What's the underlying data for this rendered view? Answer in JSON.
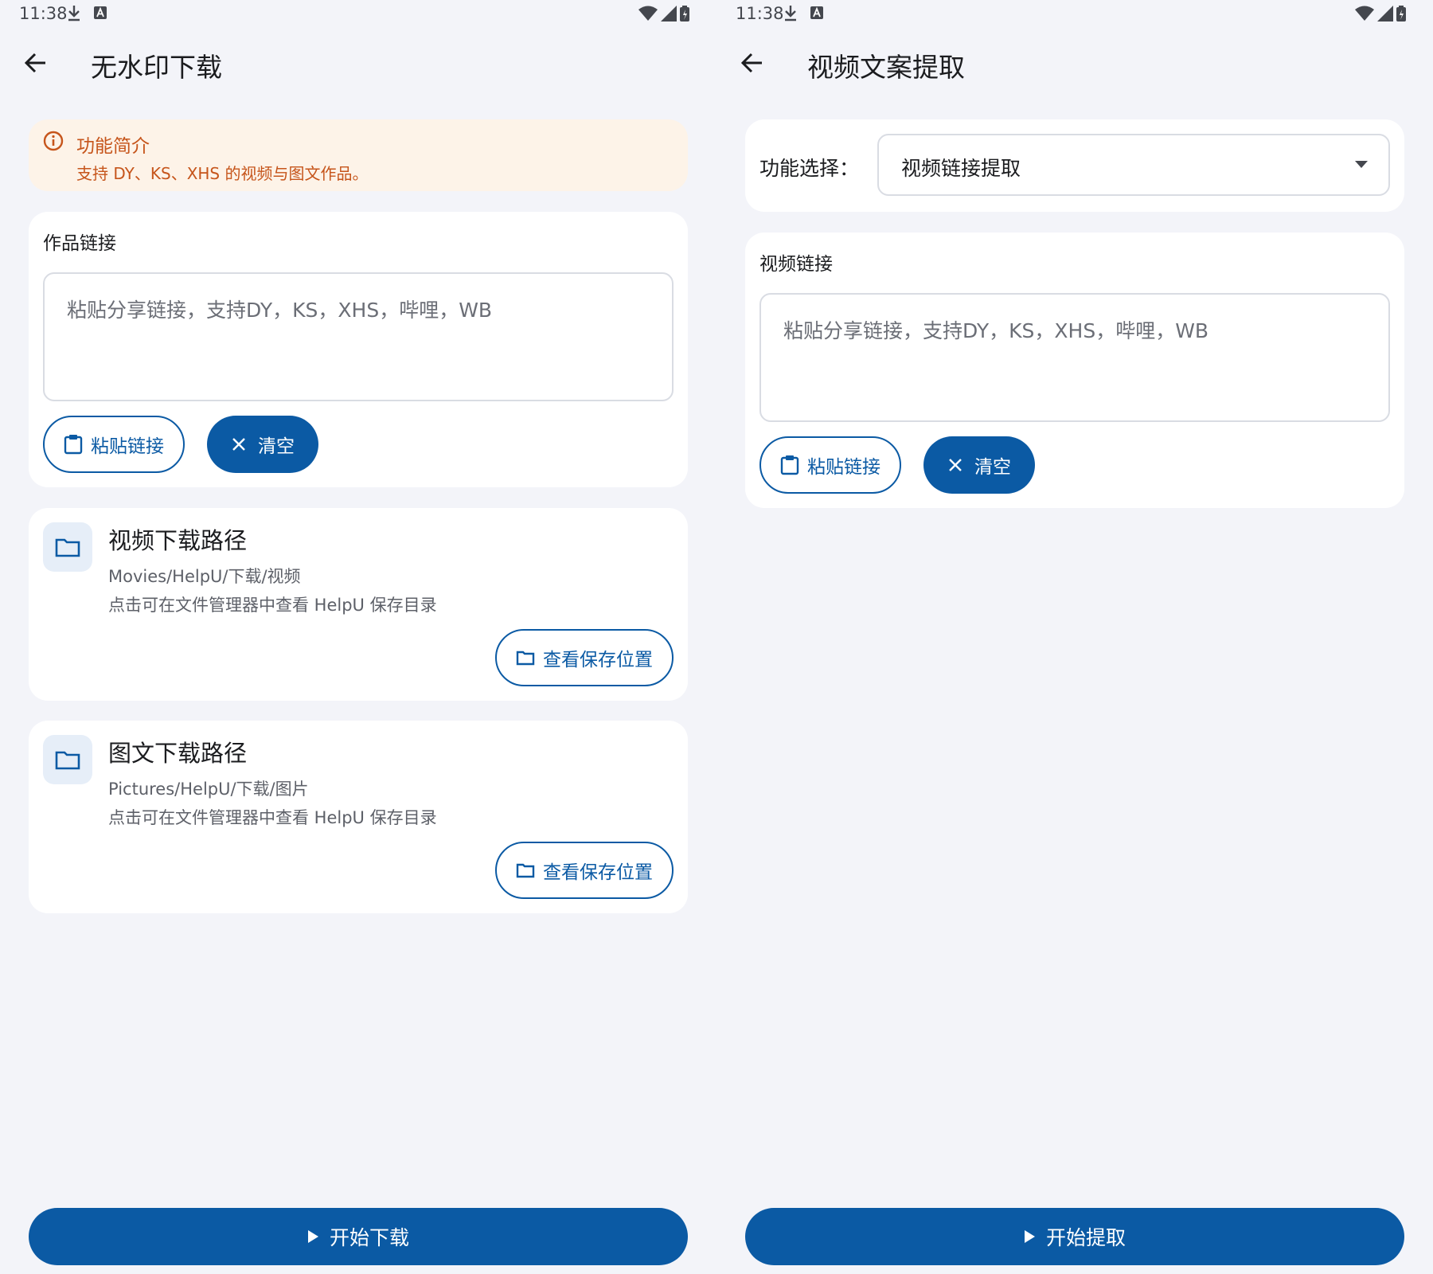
{
  "status_bar": {
    "time": "11:38"
  },
  "colors": {
    "primary": "#0b5aa4",
    "warning": "#c6551b",
    "background": "#f3f4f9"
  },
  "left": {
    "title": "无水印下载",
    "info": {
      "title": "功能简介",
      "text": "支持 DY、KS、XHS 的视频与图文作品。"
    },
    "link_card": {
      "label": "作品链接",
      "placeholder": "粘贴分享链接，支持DY，KS，XHS，哔哩，WB",
      "paste_label": "粘贴链接",
      "clear_label": "清空"
    },
    "video_path": {
      "title": "视频下载路径",
      "path": "Movies/HelpU/下载/视频",
      "hint": "点击可在文件管理器中查看 HelpU 保存目录",
      "button": "查看保存位置"
    },
    "image_path": {
      "title": "图文下载路径",
      "path": "Pictures/HelpU/下载/图片",
      "hint": "点击可在文件管理器中查看 HelpU 保存目录",
      "button": "查看保存位置"
    },
    "primary_button": "开始下载"
  },
  "right": {
    "title": "视频文案提取",
    "function_select": {
      "label": "功能选择：",
      "value": "视频链接提取"
    },
    "link_card": {
      "label": "视频链接",
      "placeholder": "粘贴分享链接，支持DY，KS，XHS，哔哩，WB",
      "paste_label": "粘贴链接",
      "clear_label": "清空"
    },
    "primary_button": "开始提取"
  }
}
